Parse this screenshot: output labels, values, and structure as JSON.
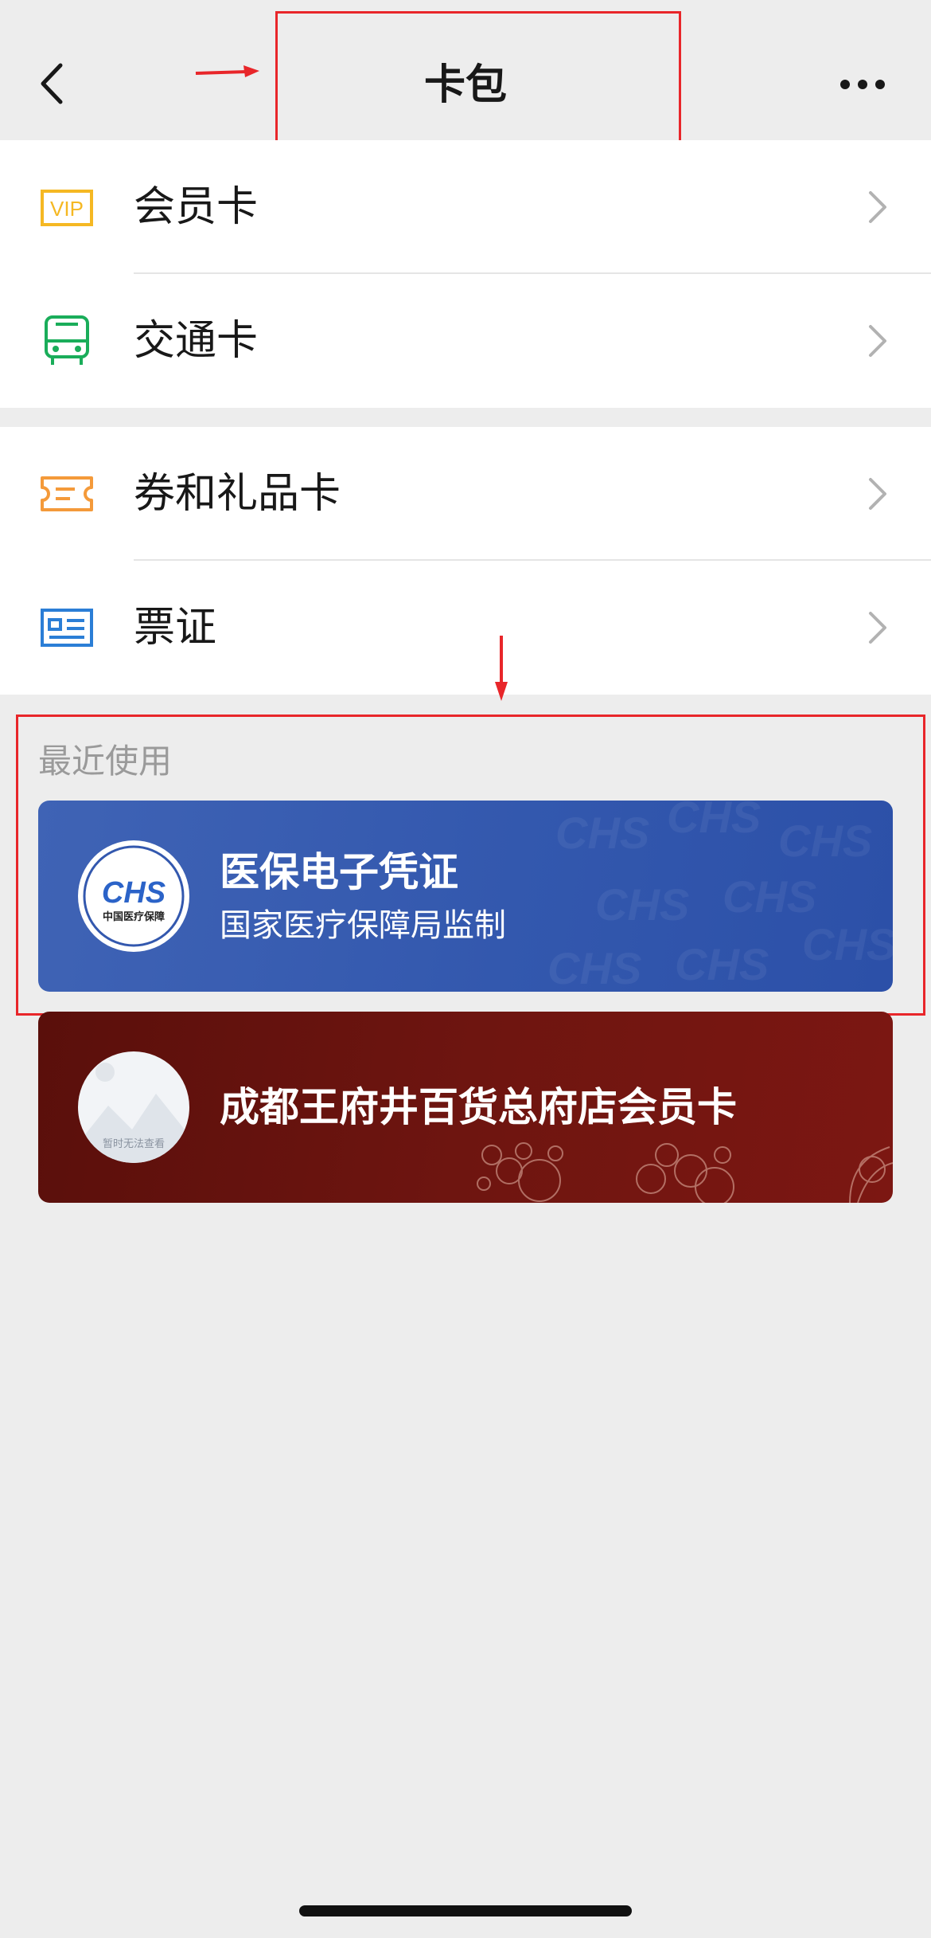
{
  "header": {
    "title": "卡包"
  },
  "menu": {
    "group1": [
      {
        "label": "会员卡",
        "icon": "vip-icon",
        "icon_text": "VIP"
      },
      {
        "label": "交通卡",
        "icon": "bus-icon"
      }
    ],
    "group2": [
      {
        "label": "券和礼品卡",
        "icon": "ticket-icon"
      },
      {
        "label": "票证",
        "icon": "id-card-icon"
      }
    ]
  },
  "recent": {
    "label": "最近使用",
    "cards": [
      {
        "title": "医保电子凭证",
        "subtitle": "国家医疗保障局监制",
        "logo_text": "CHS",
        "logo_caption": "中国医疗保障"
      },
      {
        "title": "成都王府井百货总府店会员卡",
        "logo_caption": "暂时无法查看"
      }
    ]
  },
  "colors": {
    "vip": "#f5b823",
    "bus": "#1aad5a",
    "ticket": "#f49a3a",
    "idcard": "#2b7ed6",
    "annotation": "#e8262a",
    "card_blue": "#3358ae",
    "card_red": "#6e1510"
  }
}
